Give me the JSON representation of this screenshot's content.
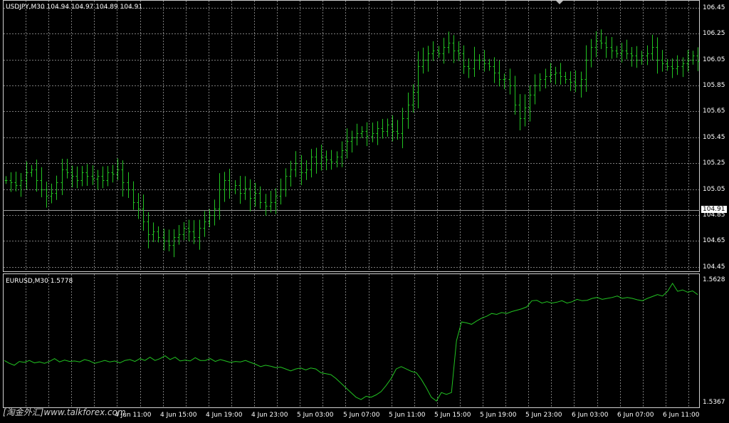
{
  "colors": {
    "background": "#000000",
    "grid": "#7a7a7a",
    "frame": "#d0d0d0",
    "bars": "#22c322",
    "line": "#22c322",
    "text": "#ffffff"
  },
  "watermark": "[淘金外汇]www.talkforex.com",
  "top_panel": {
    "header": "USDJPY,M30  104.94 104.97 104.89 104.91",
    "current_price": "104.91",
    "y_ticks": [
      "106.45",
      "106.25",
      "106.05",
      "105.85",
      "105.65",
      "105.45",
      "105.25",
      "105.05",
      "104.85",
      "104.65",
      "104.45"
    ]
  },
  "bottom_panel": {
    "header": "EURUSD,M30 1.5778",
    "y_ticks": [
      "1.5628",
      "1.5367"
    ]
  },
  "x_ticks": [
    "4 Jun 11:00",
    "4 Jun 15:00",
    "4 Jun 19:00",
    "4 Jun 23:00",
    "5 Jun 03:00",
    "5 Jun 07:00",
    "5 Jun 11:00",
    "5 Jun 15:00",
    "5 Jun 19:00",
    "5 Jun 23:00",
    "6 Jun 03:00",
    "6 Jun 07:00",
    "6 Jun 11:00"
  ],
  "chart_data": [
    {
      "type": "ohlc",
      "symbol": "USDJPY",
      "timeframe": "M30",
      "ylim": [
        104.42,
        106.5
      ],
      "close": [
        105.12,
        105.1,
        105.08,
        105.12,
        105.18,
        105.2,
        105.12,
        105.05,
        105.0,
        105.02,
        105.1,
        105.2,
        105.18,
        105.15,
        105.12,
        105.18,
        105.15,
        105.13,
        105.15,
        105.12,
        105.18,
        105.17,
        105.2,
        105.1,
        105.05,
        104.95,
        104.9,
        104.8,
        104.7,
        104.72,
        104.68,
        104.65,
        104.62,
        104.68,
        104.7,
        104.75,
        104.72,
        104.68,
        104.75,
        104.8,
        104.85,
        104.9,
        105.05,
        105.12,
        105.05,
        105.08,
        105.02,
        105.06,
        104.98,
        105.02,
        104.95,
        104.92,
        104.95,
        105.0,
        105.05,
        105.15,
        105.2,
        105.25,
        105.18,
        105.2,
        105.3,
        105.25,
        105.3,
        105.28,
        105.26,
        105.3,
        105.35,
        105.42,
        105.45,
        105.48,
        105.5,
        105.46,
        105.48,
        105.52,
        105.5,
        105.55,
        105.5,
        105.48,
        105.6,
        105.7,
        105.8,
        106.0,
        106.05,
        106.1,
        106.12,
        106.1,
        106.15,
        106.18,
        106.12,
        106.1,
        106.0,
        105.98,
        106.05,
        106.05,
        106.02,
        106.0,
        105.95,
        105.9,
        105.9,
        105.85,
        105.7,
        105.6,
        105.68,
        105.78,
        105.85,
        105.9,
        105.92,
        105.94,
        105.95,
        105.92,
        105.9,
        105.88,
        105.85,
        105.9,
        106.05,
        106.15,
        106.2,
        106.18,
        106.15,
        106.12,
        106.1,
        106.12,
        106.1,
        106.08,
        106.05,
        106.08,
        106.1,
        106.15,
        106.05,
        106.02,
        106.0,
        105.98,
        106.0,
        106.02,
        106.05,
        106.08,
        106.04
      ]
    },
    {
      "type": "line",
      "symbol": "EURUSD",
      "timeframe": "M30",
      "ylim": [
        1.536,
        1.564
      ],
      "values": [
        1.5458,
        1.5452,
        1.5448,
        1.5456,
        1.5454,
        1.5458,
        1.5453,
        1.5455,
        1.5452,
        1.5456,
        1.5462,
        1.5455,
        1.5459,
        1.5456,
        1.5457,
        1.5455,
        1.546,
        1.5457,
        1.5452,
        1.5455,
        1.5458,
        1.5455,
        1.5457,
        1.5453,
        1.5458,
        1.546,
        1.5456,
        1.5462,
        1.5458,
        1.5465,
        1.5458,
        1.5462,
        1.5468,
        1.546,
        1.5465,
        1.5457,
        1.5459,
        1.5457,
        1.5464,
        1.5458,
        1.5458,
        1.5462,
        1.5456,
        1.546,
        1.5457,
        1.5454,
        1.5456,
        1.5455,
        1.5458,
        1.5454,
        1.545,
        1.5445,
        1.5448,
        1.5446,
        1.5443,
        1.5444,
        1.544,
        1.5436,
        1.544,
        1.5442,
        1.5438,
        1.5442,
        1.544,
        1.5432,
        1.543,
        1.5428,
        1.542,
        1.541,
        1.54,
        1.539,
        1.538,
        1.5375,
        1.5382,
        1.538,
        1.5385,
        1.5392,
        1.5405,
        1.542,
        1.544,
        1.5445,
        1.544,
        1.5435,
        1.5432,
        1.5418,
        1.54,
        1.538,
        1.5372,
        1.539,
        1.5386,
        1.539,
        1.55,
        1.554,
        1.5538,
        1.5535,
        1.5542,
        1.5548,
        1.5552,
        1.5558,
        1.5556,
        1.556,
        1.5558,
        1.5562,
        1.5565,
        1.5568,
        1.5572,
        1.5585,
        1.5586,
        1.558,
        1.5583,
        1.558,
        1.5582,
        1.5585,
        1.558,
        1.5583,
        1.5588,
        1.5585,
        1.5586,
        1.559,
        1.5592,
        1.5588,
        1.559,
        1.5592,
        1.5595,
        1.559,
        1.5592,
        1.559,
        1.5587,
        1.5585,
        1.559,
        1.5594,
        1.5598,
        1.5595,
        1.5605,
        1.5622,
        1.5605,
        1.5608,
        1.5603,
        1.5606,
        1.5598
      ]
    }
  ]
}
